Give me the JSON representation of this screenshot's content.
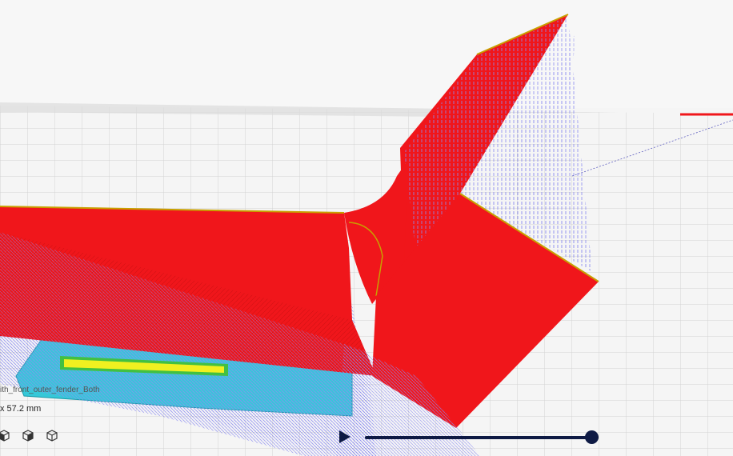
{
  "object_info": {
    "name": "ith_front_outer_fender_Both",
    "dimensions": "x 57.2 mm"
  },
  "view_buttons": [
    {
      "icon": "left-view-icon"
    },
    {
      "icon": "right-view-icon"
    },
    {
      "icon": "3d-view-icon"
    }
  ],
  "layer_slider": {
    "play_icon": "play-icon",
    "level": 0.97
  },
  "colors": {
    "wall": "#f0161b",
    "travel": "#8c8cf0",
    "skirt": "#35c8d8",
    "infill": "#f0f020",
    "support": "#42c042",
    "slider": "#0e1a44",
    "build_plate": "#f5f5f5",
    "grid_line": "#d2d2d2"
  }
}
